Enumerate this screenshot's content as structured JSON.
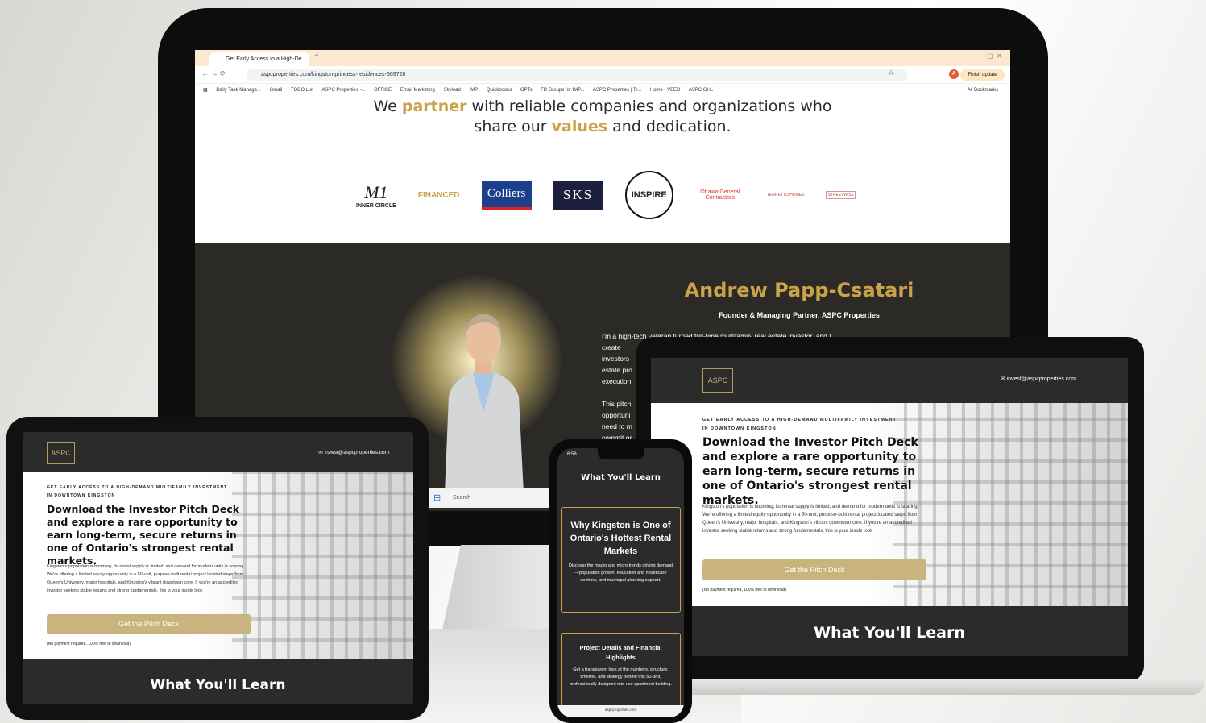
{
  "browser": {
    "tab_title": "Get Early Access to a High-De",
    "url": "aspcproperties.com/kingston-princess-residences-669728",
    "finish_update": "Finish update",
    "profile_initial": "A",
    "bookmarks": [
      "Daily Task Manage...",
      "Gmail",
      "TODO List",
      "ASPC Properties -...",
      "OFFICE",
      "Email Marketing",
      "Skylead",
      "IMP",
      "Quickbooks",
      "GPTs",
      "FB Groups for IMP...",
      "ASPC Properties | Tr...",
      "Home - VEED",
      "ASPC GHL"
    ],
    "all_bookmarks": "All Bookmarks"
  },
  "partner": {
    "line1_a": "We ",
    "line1_gold": "partner",
    "line1_b": " with reliable companies and organizations who",
    "line2_a": "share our ",
    "line2_gold": "values",
    "line2_b": " and dedication.",
    "logos": [
      "M1",
      "INNER CIRCLE",
      "FINANCED",
      "Colliers",
      "SKS",
      "INSPIRE",
      "Ottawa General Contractors",
      "TERRETTO HOMES",
      "STREETWISE"
    ]
  },
  "founder": {
    "name": "Andrew Papp-Csatari",
    "role": "Founder & Managing Partner, ASPC Properties",
    "bio1": "I'm a high-tech veteran turned full-time multifamily real estate investor, and I create",
    "bio1b": "investors",
    "bio1c": "estate pro",
    "bio1d": "execution",
    "bio2": "This pitch",
    "bio2b": "opportuni",
    "bio2c": "need to m",
    "bio2d": "commit or"
  },
  "taskbar": {
    "search": "Search"
  },
  "landing": {
    "email": "invest@aspcproperties.com",
    "logo_text": "ASPC",
    "eyebrow": "GET EARLY ACCESS TO A HIGH-DEMAND MULTIFAMILY INVESTMENT",
    "eyebrow2": "IN DOWNTOWN KINGSTON",
    "headline": "Download the Investor Pitch Deck and explore a rare opportunity to earn long-term, secure returns in one of Ontario's strongest rental markets.",
    "body": "Kingston's population is booming, its rental supply is limited, and demand for modern units is soaring. We're offering a limited equity opportunity in a 50-unit, purpose-built rental project located steps from Queen's University, major hospitals, and Kingston's vibrant downtown core. If you're an accredited investor seeking stable returns and strong fundamentals, this is your inside look",
    "cta": "Get the Pitch Deck",
    "note": "(No payment required, 100% free to download)",
    "section_title": "What You'll Learn"
  },
  "phone": {
    "time": "6:56",
    "section_title": "What You'll Learn",
    "card1_title": "Why Kingston is One of Ontario's Hottest Rental Markets",
    "card1_body": "Discover the macro and micro trends driving demand—population growth, education and healthcare anchors, and municipal planning support.",
    "card2_title": "Project Details and Financial Highlights",
    "card2_body": "Get a transparent look at the numbers, structure, timeline, and strategy behind this 50-unit, professionally designed mid-rise apartment building.",
    "url": "aspcproperties.com"
  }
}
